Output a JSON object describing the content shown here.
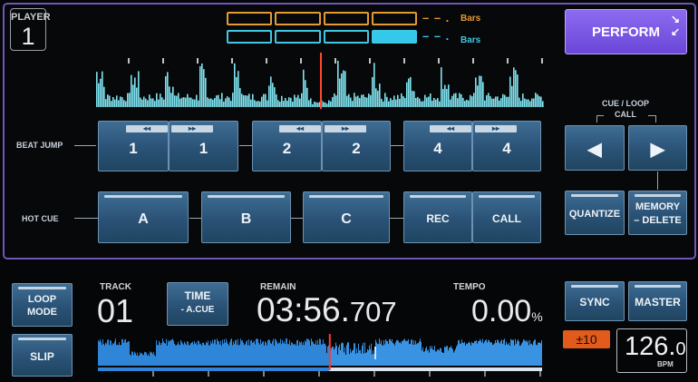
{
  "player": {
    "label": "PLAYER",
    "number": "1"
  },
  "bars": {
    "orange_label": "Bars",
    "blue_label": "Bars",
    "orange_dash": "– – .",
    "blue_dash": "– – ."
  },
  "perform": {
    "label": "PERFORM",
    "icon": "collapse-arrows-icon"
  },
  "beat_jump": {
    "label": "BEAT JUMP",
    "buttons": [
      {
        "label": "1",
        "tab": "◂◂"
      },
      {
        "label": "1",
        "tab": "▸▸"
      },
      {
        "label": "2",
        "tab": "◂◂"
      },
      {
        "label": "2",
        "tab": "▸▸"
      },
      {
        "label": "4",
        "tab": "◂◂"
      },
      {
        "label": "4",
        "tab": "▸▸"
      }
    ]
  },
  "hot_cue": {
    "label": "HOT CUE",
    "buttons": [
      "A",
      "B",
      "C",
      "REC",
      "CALL"
    ]
  },
  "cue_loop": {
    "label_line1": "CUE / LOOP",
    "label_line2": "CALL",
    "prev_icon": "◀",
    "next_icon": "▶"
  },
  "quantize": {
    "label": "QUANTIZE"
  },
  "memory": {
    "line1": "MEMORY",
    "line2": "– DELETE"
  },
  "loop_mode": {
    "line1": "LOOP",
    "line2": "MODE"
  },
  "slip": {
    "label": "SLIP"
  },
  "track": {
    "label": "TRACK",
    "value": "01"
  },
  "time_mode": {
    "line1": "TIME",
    "line2": "- A.CUE"
  },
  "remain": {
    "label": "REMAIN",
    "main": "03:56.",
    "ms": "707"
  },
  "tempo": {
    "label": "TEMPO",
    "value": "0.00",
    "unit": "%"
  },
  "sync": {
    "label": "SYNC"
  },
  "master": {
    "label": "MASTER"
  },
  "key_shift": {
    "label": "±10"
  },
  "bpm": {
    "main": "126.",
    "decimal": "0",
    "unit": "BPM"
  },
  "colors": {
    "accent_purple": "#7a58e6",
    "waveform_cyan": "#7fe3f0",
    "overview_blue": "#2f86d8",
    "playhead_red": "#ff3b2f",
    "bars_orange": "#e49a34",
    "bars_blue": "#3fc7e6",
    "key_orange": "#e25b1c"
  },
  "playback_progress": 0.52
}
